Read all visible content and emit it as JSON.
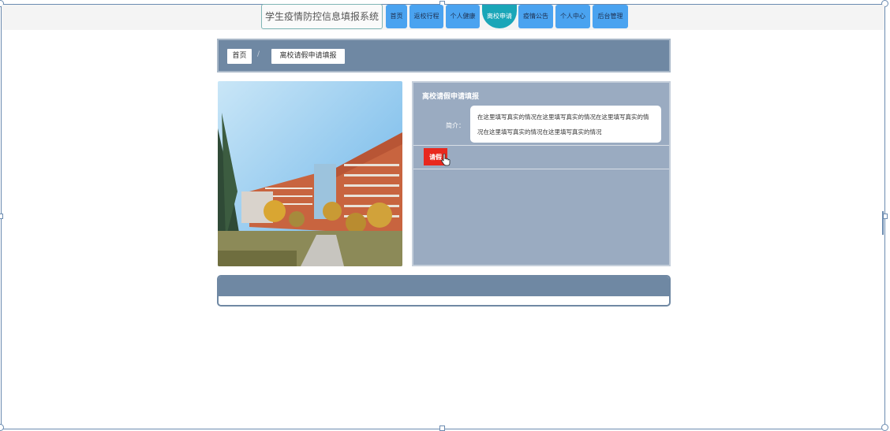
{
  "site": {
    "title": "学生疫情防控信息填报系统"
  },
  "nav": {
    "items": [
      {
        "label": "首页",
        "active": false
      },
      {
        "label": "返校行程",
        "active": false
      },
      {
        "label": "个人健康",
        "active": false
      },
      {
        "label": "离校申请",
        "active": true
      },
      {
        "label": "疫情公告",
        "active": false
      },
      {
        "label": "个人中心",
        "active": false
      },
      {
        "label": "后台管理",
        "active": false
      }
    ]
  },
  "breadcrumb": {
    "home": "首页",
    "separator": "/",
    "current": "离校请假申请填报"
  },
  "panel": {
    "title": "离校请假申请填报",
    "intro_label": "简介：",
    "intro_text": "在这里填写真实的情况在这里填写真实的情况在这里填写真实的情况在这里填写真实的情况在这里填写真实的情况",
    "button_label": "请假"
  },
  "colors": {
    "nav": "#4aa3f0",
    "nav_active": "#1aa6b8",
    "header_bar": "#6f88a3",
    "panel": "#9aabc1",
    "button": "#e8281e"
  },
  "icons": {
    "cursor": "hand-pointer-icon"
  }
}
